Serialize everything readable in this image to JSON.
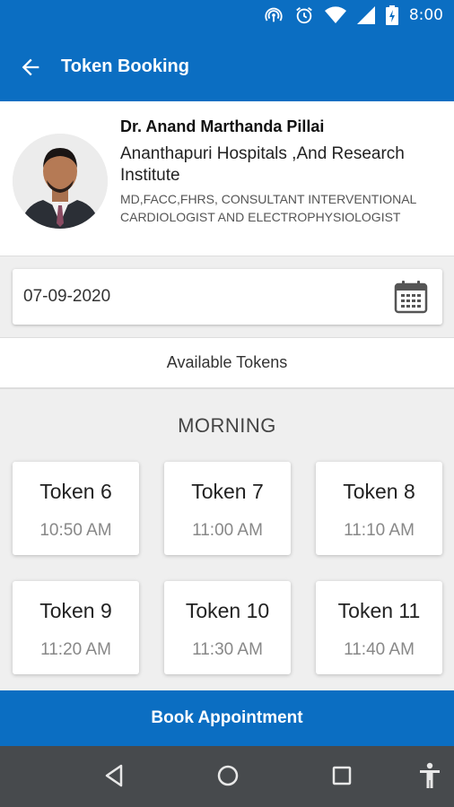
{
  "status_bar": {
    "time": "8:00"
  },
  "app_bar": {
    "title": "Token Booking"
  },
  "doctor": {
    "name": "Dr. Anand Marthanda Pillai",
    "hospital": "Ananthapuri Hospitals ,And Research Institute",
    "qualification": "MD,FACC,FHRS, CONSULTANT INTERVENTIONAL CARDIOLOGIST AND ELECTROPHYSIOLOGIST"
  },
  "date_field": {
    "value": "07-09-2020"
  },
  "available_tokens_label": "Available Tokens",
  "session": "MORNING",
  "tokens": [
    {
      "name": "Token 6",
      "time": "10:50 AM"
    },
    {
      "name": "Token 7",
      "time": "11:00 AM"
    },
    {
      "name": "Token 8",
      "time": "11:10 AM"
    },
    {
      "name": "Token 9",
      "time": "11:20 AM"
    },
    {
      "name": "Token 10",
      "time": "11:30 AM"
    },
    {
      "name": "Token 11",
      "time": "11:40 AM"
    }
  ],
  "book_button": "Book Appointment",
  "colors": {
    "primary": "#0b6ec2",
    "nav_bar": "#474a4d",
    "background": "#efefef"
  },
  "icons": [
    "hotspot-icon",
    "alarm-icon",
    "wifi-icon",
    "signal-icon",
    "battery-icon",
    "back-arrow-icon",
    "calendar-icon",
    "nav-back-icon",
    "nav-home-icon",
    "nav-recents-icon",
    "accessibility-icon"
  ]
}
